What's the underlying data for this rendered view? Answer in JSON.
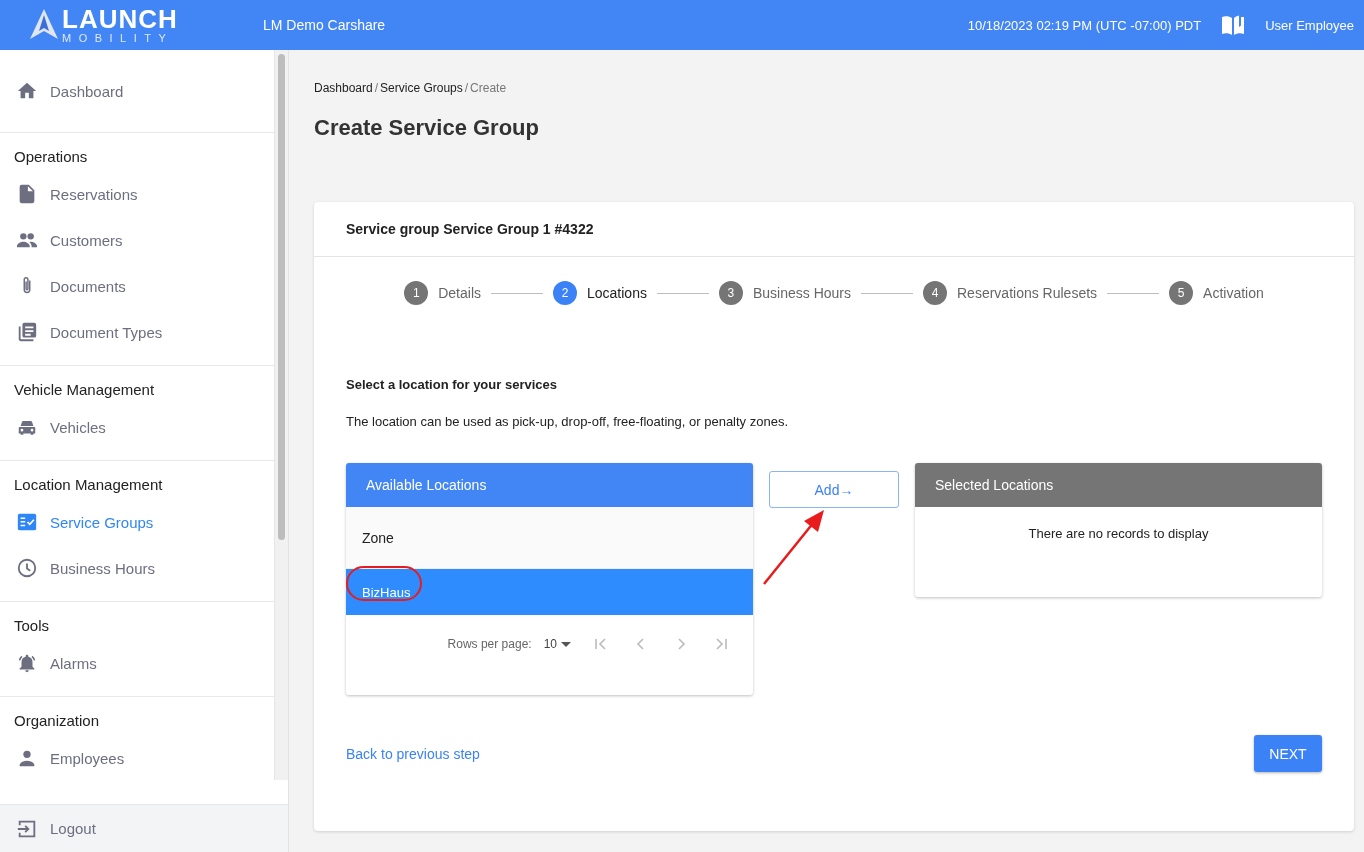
{
  "header": {
    "brand_line_1": "LAUNCH",
    "brand_line_2": "MOBILITY",
    "org": "LM Demo Carshare",
    "datetime": "10/18/2023 02:19 PM (UTC -07:00) PDT",
    "user": "User Employee"
  },
  "sidebar": {
    "top_items": [
      {
        "label": "Dashboard",
        "kind": "home",
        "selected": false
      }
    ],
    "sections": [
      {
        "title": "Operations",
        "items": [
          {
            "label": "Reservations",
            "kind": "file",
            "selected": false
          },
          {
            "label": "Customers",
            "kind": "people",
            "selected": false
          },
          {
            "label": "Documents",
            "kind": "clip",
            "selected": false
          },
          {
            "label": "Document Types",
            "kind": "stack",
            "selected": false
          }
        ]
      },
      {
        "title": "Vehicle Management",
        "items": [
          {
            "label": "Vehicles",
            "kind": "car",
            "selected": false
          }
        ]
      },
      {
        "title": "Location Management",
        "items": [
          {
            "label": "Service Groups",
            "kind": "checklist",
            "selected": true
          },
          {
            "label": "Business Hours",
            "kind": "clock",
            "selected": false
          }
        ]
      },
      {
        "title": "Tools",
        "items": [
          {
            "label": "Alarms",
            "kind": "bell",
            "selected": false
          }
        ]
      },
      {
        "title": "Organization",
        "items": [
          {
            "label": "Employees",
            "kind": "person",
            "selected": false
          }
        ]
      }
    ],
    "logout": "Logout"
  },
  "breadcrumb": [
    {
      "label": "Dashboard",
      "current": false
    },
    {
      "label": "Service Groups",
      "current": false
    },
    {
      "label": "Create",
      "current": true
    }
  ],
  "breadcrumb_separator": "/",
  "page_title": "Create Service Group",
  "card": {
    "title": "Service group Service Group 1 #4322",
    "steps": [
      {
        "number": "1",
        "label": "Details",
        "selected": false
      },
      {
        "number": "2",
        "label": "Locations",
        "selected": true
      },
      {
        "number": "3",
        "label": "Business Hours",
        "selected": false
      },
      {
        "number": "4",
        "label": "Reservations Rulesets",
        "selected": false
      },
      {
        "number": "5",
        "label": "Activation",
        "selected": false
      }
    ],
    "heading": "Select a location for your services",
    "description": "The location can be used as pick-up, drop-off, free-floating, or penalty zones.",
    "available": {
      "title": "Available Locations",
      "column": "Zone",
      "rows": [
        {
          "label": "BizHaus",
          "selected": true
        }
      ],
      "rows_per_page_label": "Rows per page:",
      "rows_per_page": "10"
    },
    "add_button": "Add→",
    "selected": {
      "title": "Selected Locations",
      "empty": "There are no records to display"
    },
    "back_link": "Back to previous step",
    "next_button": "NEXT"
  }
}
